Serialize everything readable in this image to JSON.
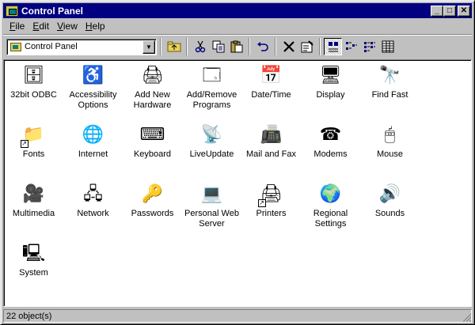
{
  "window": {
    "title": "Control Panel",
    "caption": {
      "minimize": "_",
      "maximize": "□",
      "close": "✕"
    }
  },
  "menu": [
    {
      "label": "File",
      "key": "F",
      "rest": "ile"
    },
    {
      "label": "Edit",
      "key": "E",
      "rest": "dit"
    },
    {
      "label": "View",
      "key": "V",
      "rest": "iew"
    },
    {
      "label": "Help",
      "key": "H",
      "rest": "elp"
    }
  ],
  "address": {
    "value": "Control Panel"
  },
  "toolbar": {
    "up_icon": "folder-up-icon",
    "cut_icon": "scissors-icon",
    "copy_icon": "copy-icon",
    "paste_icon": "paste-icon",
    "undo_icon": "undo-icon",
    "delete_icon": "delete-x-icon",
    "properties_icon": "properties-icon",
    "views": [
      "large-icons-icon",
      "small-icons-icon",
      "list-icon",
      "details-icon"
    ],
    "active_view": "large-icons-icon"
  },
  "items": [
    {
      "label": "32bit ODBC",
      "icon": "odbc-icon",
      "glyph": "🗄",
      "shortcut": false
    },
    {
      "label": "Accessibility Options",
      "icon": "accessibility-icon",
      "glyph": "♿",
      "shortcut": false
    },
    {
      "label": "Add New Hardware",
      "icon": "hardware-icon",
      "glyph": "🖨",
      "shortcut": false
    },
    {
      "label": "Add/Remove Programs",
      "icon": "programs-icon",
      "glyph": "🗔",
      "shortcut": false
    },
    {
      "label": "Date/Time",
      "icon": "calendar-clock-icon",
      "glyph": "📅",
      "shortcut": false
    },
    {
      "label": "Display",
      "icon": "display-icon",
      "glyph": "🖥",
      "shortcut": false
    },
    {
      "label": "Find Fast",
      "icon": "binoculars-icon",
      "glyph": "🔭",
      "shortcut": false
    },
    {
      "label": "Fonts",
      "icon": "fonts-folder-icon",
      "glyph": "📁",
      "shortcut": true
    },
    {
      "label": "Internet",
      "icon": "globe-icon",
      "glyph": "🌐",
      "shortcut": false
    },
    {
      "label": "Keyboard",
      "icon": "keyboard-icon",
      "glyph": "⌨",
      "shortcut": false
    },
    {
      "label": "LiveUpdate",
      "icon": "liveupdate-icon",
      "glyph": "📡",
      "shortcut": false
    },
    {
      "label": "Mail and Fax",
      "icon": "mail-fax-icon",
      "glyph": "📠",
      "shortcut": false
    },
    {
      "label": "Modems",
      "icon": "telephone-icon",
      "glyph": "☎",
      "shortcut": false
    },
    {
      "label": "Mouse",
      "icon": "mouse-icon",
      "glyph": "🖱",
      "shortcut": false
    },
    {
      "label": "Multimedia",
      "icon": "multimedia-icon",
      "glyph": "🎥",
      "shortcut": false
    },
    {
      "label": "Network",
      "icon": "network-icon",
      "glyph": "🖧",
      "shortcut": false
    },
    {
      "label": "Passwords",
      "icon": "keys-icon",
      "glyph": "🔑",
      "shortcut": false
    },
    {
      "label": "Personal Web Server",
      "icon": "web-server-icon",
      "glyph": "💻",
      "shortcut": false
    },
    {
      "label": "Printers",
      "icon": "printer-folder-icon",
      "glyph": "🖨",
      "shortcut": true
    },
    {
      "label": "Regional Settings",
      "icon": "globe-regional-icon",
      "glyph": "🌍",
      "shortcut": false
    },
    {
      "label": "Sounds",
      "icon": "speaker-icon",
      "glyph": "🔊",
      "shortcut": false
    },
    {
      "label": "System",
      "icon": "computer-icon",
      "glyph": "🖳",
      "shortcut": false
    }
  ],
  "status": {
    "text": "22 object(s)"
  }
}
